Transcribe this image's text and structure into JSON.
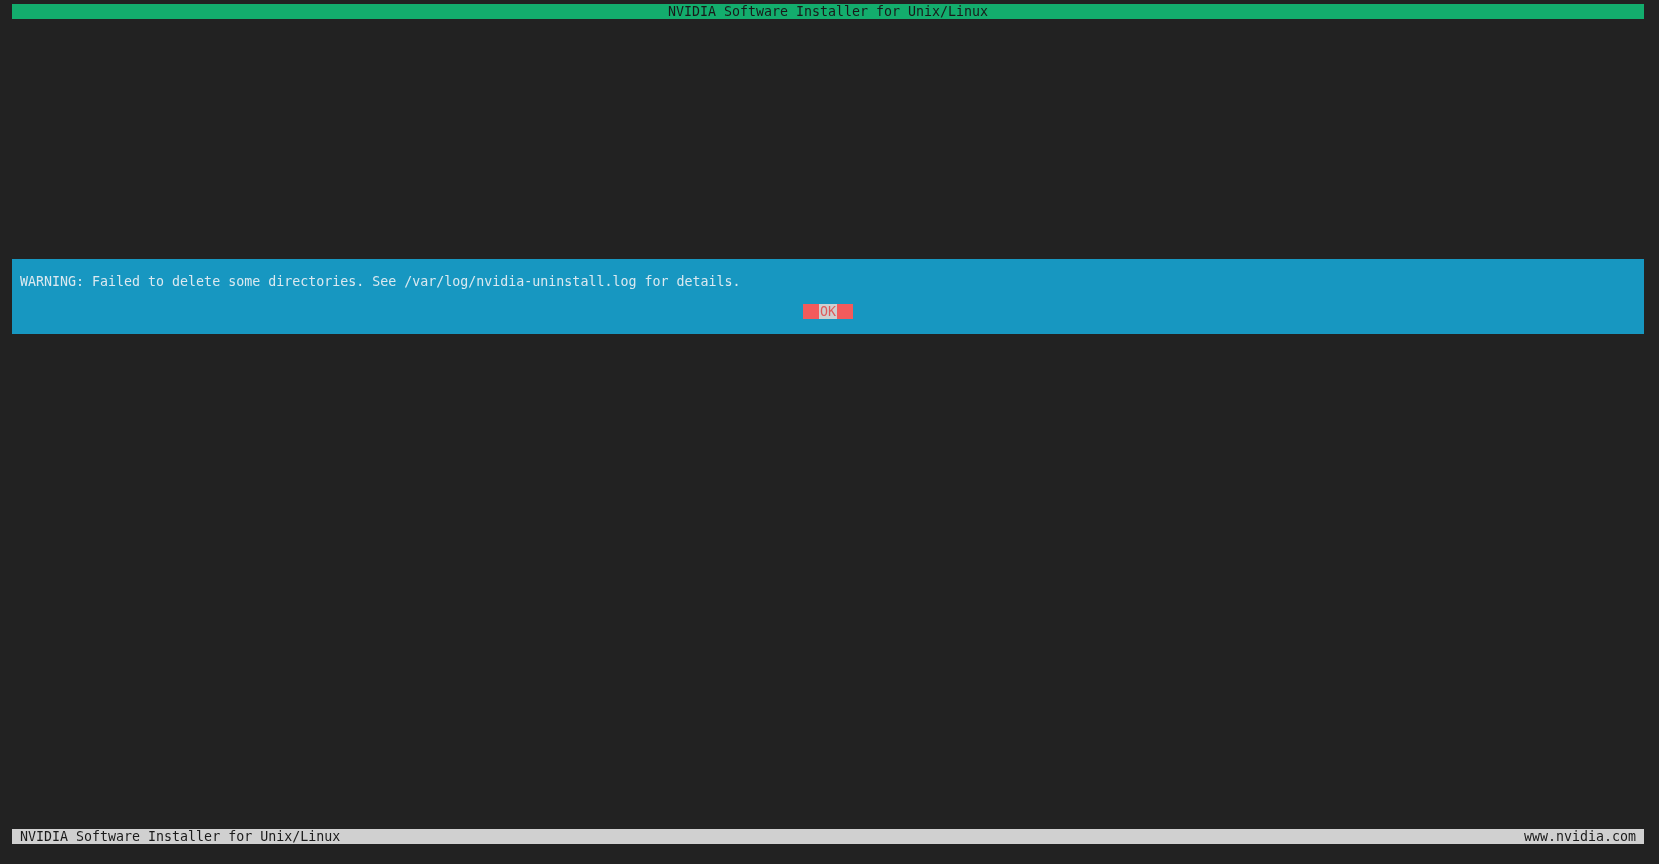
{
  "header": {
    "title": "NVIDIA Software Installer for Unix/Linux"
  },
  "dialog": {
    "message": "WARNING: Failed to delete some directories. See /var/log/nvidia-uninstall.log for details.",
    "buttons": [
      {
        "label": "OK",
        "selected": true
      }
    ]
  },
  "status_bar": {
    "left": "NVIDIA Software Installer for Unix/Linux",
    "right": "www.nvidia.com"
  }
}
